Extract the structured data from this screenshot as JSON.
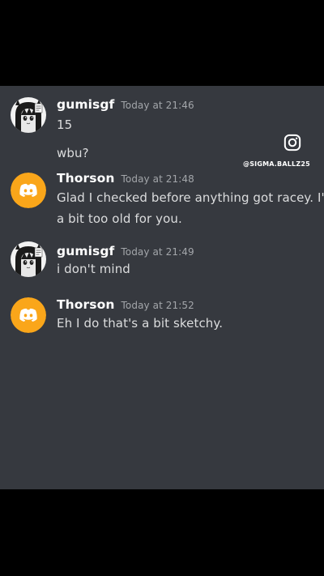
{
  "watermark": {
    "icon": "instagram-icon",
    "handle": "@SIGMA.BALLZ25"
  },
  "colors": {
    "background": "#36393f",
    "letterbox": "#000000",
    "discord_avatar": "#faa61a",
    "username": "#ffffff",
    "timestamp": "#a3a6aa",
    "message_text": "#dcddde"
  },
  "messages": [
    {
      "author": "gumisgf",
      "timestamp": "Today at 21:46",
      "avatar": "anime-girl-avatar",
      "lines": [
        "15",
        "wbu?"
      ]
    },
    {
      "author": "Thorson",
      "timestamp": "Today at 21:48",
      "avatar": "discord-default-avatar",
      "lines": [
        "Glad I checked before anything got racey. I'm",
        "a bit too old for you."
      ]
    },
    {
      "author": "gumisgf",
      "timestamp": "Today at 21:49",
      "avatar": "anime-girl-avatar",
      "lines": [
        "i don't mind"
      ]
    },
    {
      "author": "Thorson",
      "timestamp": "Today at 21:52",
      "avatar": "discord-default-avatar",
      "lines": [
        "Eh I do that's a bit sketchy."
      ]
    }
  ]
}
